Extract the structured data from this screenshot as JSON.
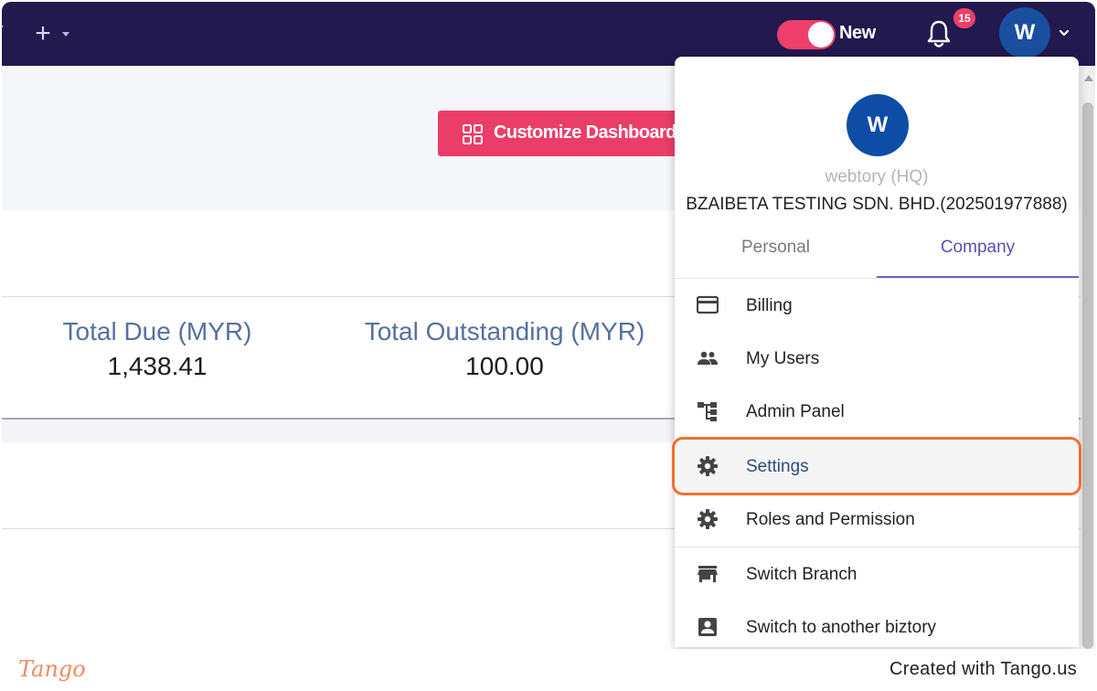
{
  "topbar": {
    "toggle_label": "New",
    "notifications_count": "15",
    "avatar_initial": "W",
    "colors": {
      "background": "#22194f",
      "accent": "#ef3f6b"
    }
  },
  "dashboard": {
    "customize_label": "Customize Dashboard",
    "stats": [
      {
        "label": "Total Due (MYR)",
        "value": "1,438.41"
      },
      {
        "label": "Total Outstanding (MYR)",
        "value": "100.00"
      }
    ]
  },
  "dropdown": {
    "avatar_initial": "W",
    "subtitle": "webtory (HQ)",
    "company_name": "BZAIBETA TESTING SDN. BHD.(202501977888)",
    "tabs": [
      {
        "label": "Personal",
        "active": false
      },
      {
        "label": "Company",
        "active": true
      }
    ],
    "items": [
      {
        "label": "Billing",
        "icon": "credit-card-icon"
      },
      {
        "label": "My Users",
        "icon": "users-icon"
      },
      {
        "label": "Admin Panel",
        "icon": "hierarchy-icon"
      },
      {
        "label": "Settings",
        "icon": "gear-icon",
        "active": true
      },
      {
        "label": "Roles and Permission",
        "icon": "gear-icon"
      },
      {
        "label": "Switch Branch",
        "icon": "store-icon"
      },
      {
        "label": "Switch to another biztory",
        "icon": "account-box-icon"
      }
    ]
  },
  "footer": {
    "logo": "Tango",
    "text": "Created with Tango.us"
  }
}
